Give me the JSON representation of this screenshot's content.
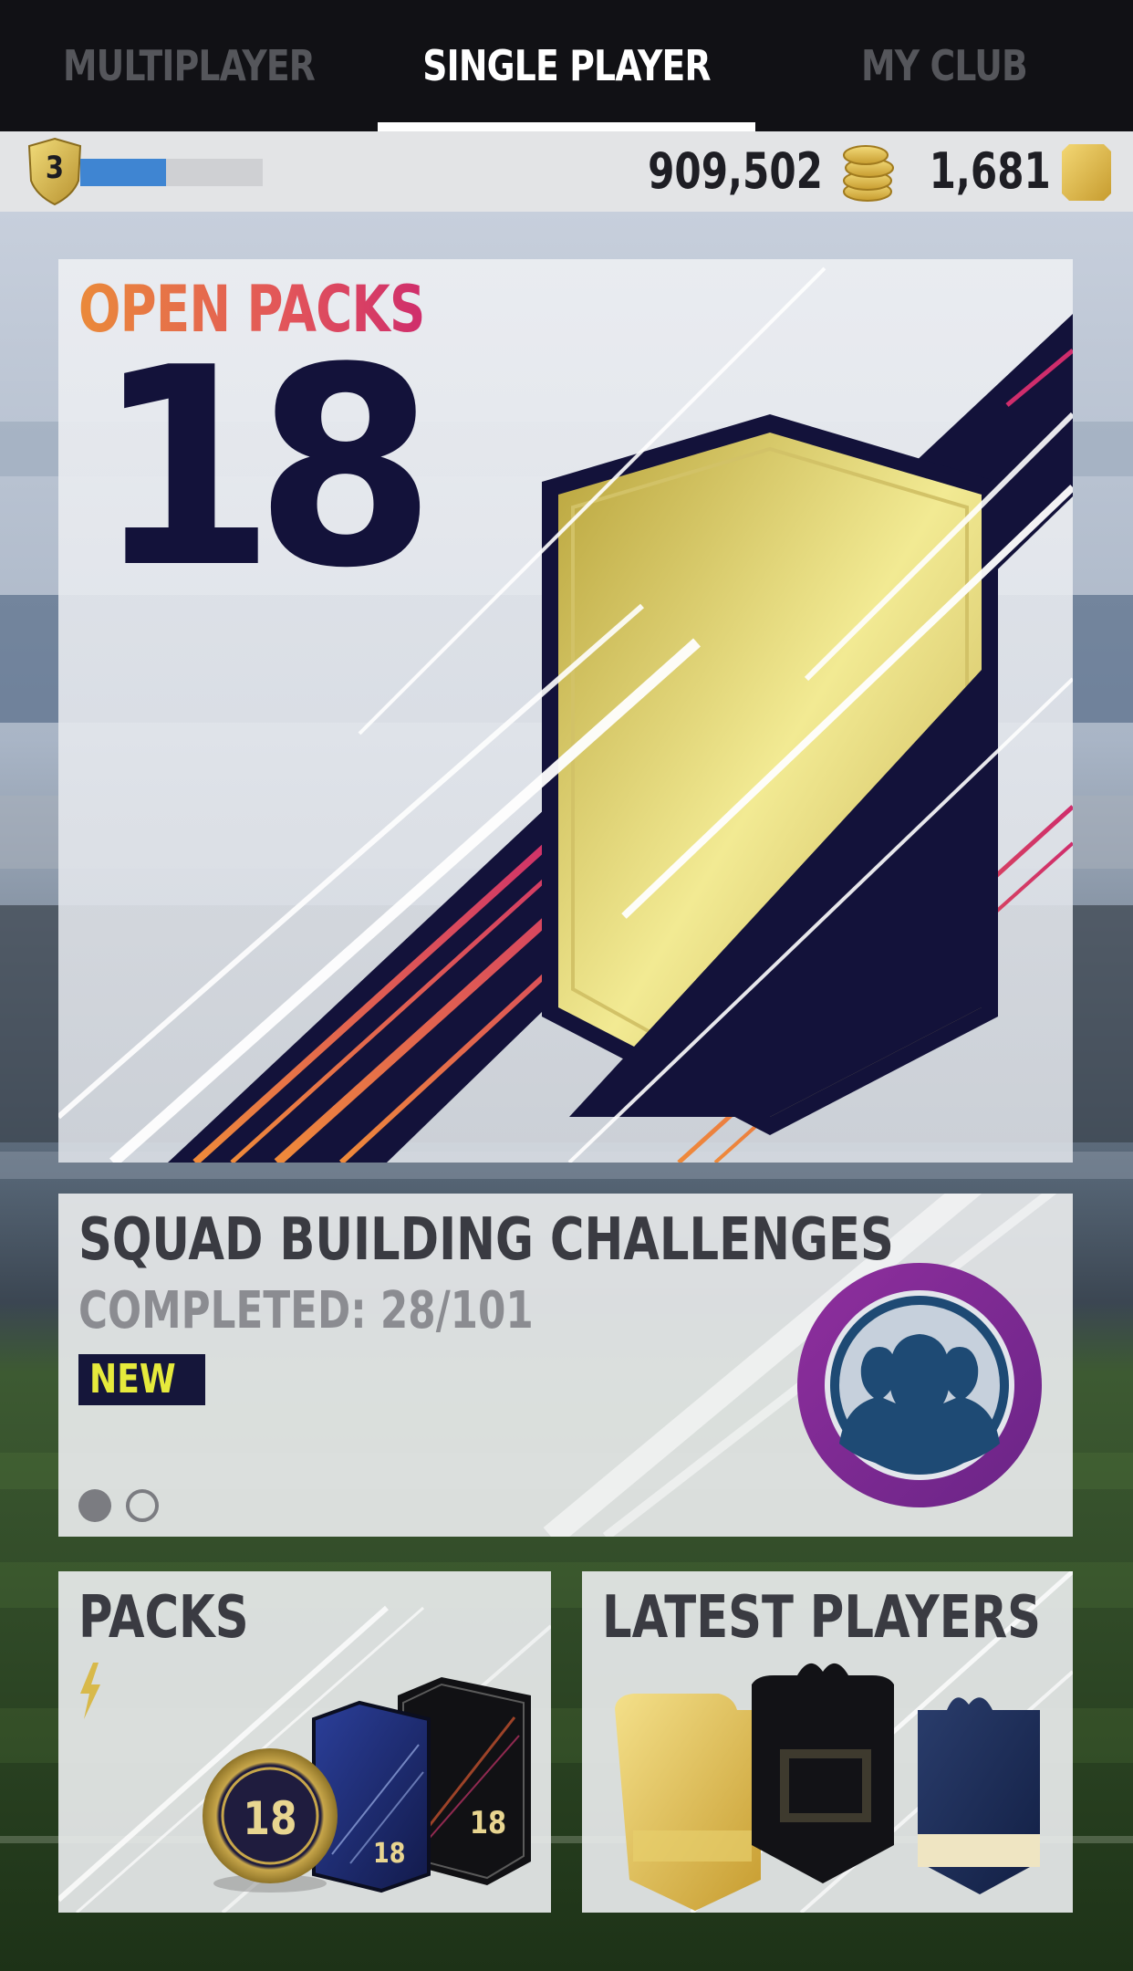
{
  "tabs": [
    {
      "label": "MULTIPLAYER",
      "active": false
    },
    {
      "label": "SINGLE PLAYER",
      "active": true
    },
    {
      "label": "MY CLUB",
      "active": false
    }
  ],
  "status": {
    "level": "3",
    "xp_progress": 0.47,
    "coins": "909,502",
    "points": "1,681"
  },
  "open_packs": {
    "title": "OPEN PACKS",
    "count": "18"
  },
  "sbc": {
    "title": "SQUAD BUILDING CHALLENGES",
    "progress": "COMPLETED: 28/101",
    "badge": "NEW",
    "pages": 2,
    "current_page": 1
  },
  "packs_tile": {
    "title": "PACKS",
    "pack_label": "18"
  },
  "latest_tile": {
    "title": "LATEST PLAYERS"
  },
  "colors": {
    "tabbar_bg": "#111115",
    "accent_orange": "#ea8a3a",
    "accent_pink": "#cf2d6c",
    "navy": "#13123a",
    "gold": "#d9c55a",
    "xp_blue": "#3f85d2",
    "new_badge_text": "#e6ea3c"
  }
}
